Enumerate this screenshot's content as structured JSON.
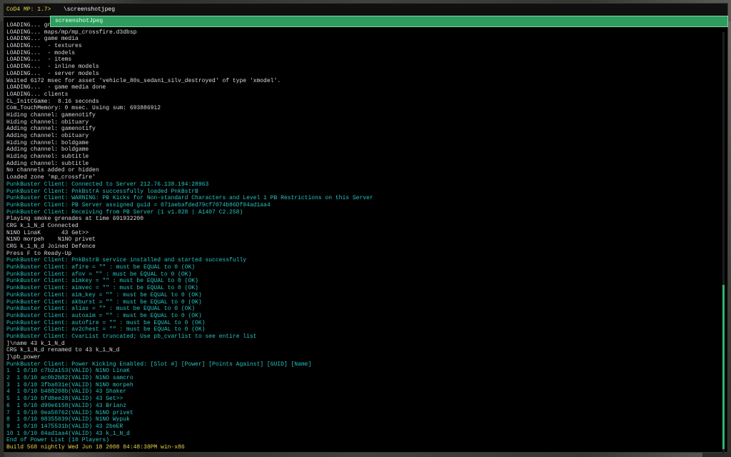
{
  "console": {
    "prompt": "CoD4 MP: 1.7> ",
    "input_value": "\\screenshotjpeg",
    "suggestion": "screenshotJpeg",
    "lines": [
      {
        "t": "LOADING... gn",
        "k": "w"
      },
      {
        "t": "LOADING... maps/mp/mp_crossfire.d3dbsp",
        "k": "w"
      },
      {
        "t": "LOADING... game media",
        "k": "w"
      },
      {
        "t": "LOADING...  - textures",
        "k": "w"
      },
      {
        "t": "LOADING...  - models",
        "k": "w"
      },
      {
        "t": "LOADING...  - items",
        "k": "w"
      },
      {
        "t": "LOADING...  - inline models",
        "k": "w"
      },
      {
        "t": "LOADING...  - server models",
        "k": "w"
      },
      {
        "t": "Waited 6172 msec for asset 'vehicle_80s_sedan1_silv_destroyed' of type 'xmodel'.",
        "k": "w"
      },
      {
        "t": "LOADING...  - game media done",
        "k": "w"
      },
      {
        "t": "LOADING... clients",
        "k": "w"
      },
      {
        "t": "CL_InitCGame:  8.16 seconds",
        "k": "w"
      },
      {
        "t": "Com_TouchMemory: 0 msec. Using sum: 693886912",
        "k": "w"
      },
      {
        "t": "Hiding channel: gamenotify",
        "k": "w"
      },
      {
        "t": "Hiding channel: obituary",
        "k": "w"
      },
      {
        "t": "Adding channel: gamenotify",
        "k": "w"
      },
      {
        "t": "Adding channel: obituary",
        "k": "w"
      },
      {
        "t": "Hiding channel: boldgame",
        "k": "w"
      },
      {
        "t": "Adding channel: boldgame",
        "k": "w"
      },
      {
        "t": "Hiding channel: subtitle",
        "k": "w"
      },
      {
        "t": "Adding channel: subtitle",
        "k": "w"
      },
      {
        "t": "No channels added or hidden",
        "k": "w"
      },
      {
        "t": "Loaded zone 'mp_crossfire'",
        "k": "w"
      },
      {
        "t": "PunkBuster Client: Connected to Server 212.76.138.194:28963",
        "k": "c"
      },
      {
        "t": "PunkBuster Client: PnkBstrA successfully loaded PnkBstrB",
        "k": "c"
      },
      {
        "t": "PunkBuster Client: WARNING: PB Kicks for Non-standard Characters and Level 1 PB Restrictions on this Server",
        "k": "c"
      },
      {
        "t": "PunkBuster Client: PB Server assigned guid = 071aebafded79cf7074b86Df04ad1aa4",
        "k": "c"
      },
      {
        "t": "PunkBuster Client: Receiving from PB Server (1 v1.828 | A1407 C2.258)",
        "k": "c"
      },
      {
        "t": "Playing smoke grenades at time 691932200",
        "k": "w"
      },
      {
        "t": "CRG k_1_N_d Connected",
        "k": "w"
      },
      {
        "t": "N1NO LinaK      43 Get>>",
        "k": "w",
        "knife": true
      },
      {
        "t": "N1NO morpeh    N1NO privet",
        "k": "w",
        "knife": true
      },
      {
        "t": "CRG k_1_N_d Joined Defence",
        "k": "w"
      },
      {
        "t": "Press F to Ready-Up",
        "k": "w"
      },
      {
        "t": "PunkBuster Client: PnkBstrB service installed and started successfully",
        "k": "c"
      },
      {
        "t": "PunkBuster Client: afire = \"\" : must be EQUAL to 0 (OK)",
        "k": "c"
      },
      {
        "t": "PunkBuster Client: afov = \"\" : must be EQUAL to 0 (OK)",
        "k": "c"
      },
      {
        "t": "PunkBuster Client: aimkey = \"\" : must be EQUAL to 0 (OK)",
        "k": "c"
      },
      {
        "t": "PunkBuster Client: aimvec = \"\" : must be EQUAL to 0 (OK)",
        "k": "c"
      },
      {
        "t": "PunkBuster Client: aim_key = \"\" : must be EQUAL to 0 (OK)",
        "k": "c"
      },
      {
        "t": "PunkBuster Client: akburst = \"\" : must be EQUAL to 0 (OK)",
        "k": "c"
      },
      {
        "t": "PunkBuster Client: alias = \"\" : must be EQUAL to 0 (OK)",
        "k": "c"
      },
      {
        "t": "PunkBuster Client: autoaim = \"\" : must be EQUAL to 0 (OK)",
        "k": "c"
      },
      {
        "t": "PunkBuster Client: autofire = \"\" : must be EQUAL to 0 (OK)",
        "k": "c"
      },
      {
        "t": "PunkBuster Client: av2chest = \"\" : must be EQUAL to 0 (OK)",
        "k": "c"
      },
      {
        "t": "PunkBuster Client: CvarList truncated; Use pb_cvarlist to see entire list",
        "k": "c"
      },
      {
        "t": "]\\name 43 k_1_N_d",
        "k": "w"
      },
      {
        "t": "CRG k_1_N_d renamed to 43 k_1_N_d",
        "k": "w"
      },
      {
        "t": "]\\pb_power",
        "k": "w"
      },
      {
        "t": "PunkBuster Client: Power Kicking Enabled: [Slot #] [Power] [Points Against] [GUID] [Name]",
        "k": "c"
      },
      {
        "t": "1  1 0/10 c7b2a153(VALID) N1NO LinaK",
        "k": "c"
      },
      {
        "t": "2  1 0/10 ac0b2b82(VALID) N1NO samcro",
        "k": "c"
      },
      {
        "t": "3  1 0/10 3fba031e(VALID) N1NO morpeh",
        "k": "c"
      },
      {
        "t": "4  1 0/10 b488208b(VALID) 43 Shaker",
        "k": "c"
      },
      {
        "t": "5  1 0/10 bfd8ee28(VALID) 43 Get>>",
        "k": "c"
      },
      {
        "t": "6  1 0/10 d99e6158(VALID) 43 Brianz",
        "k": "c"
      },
      {
        "t": "7  1 0/10 0ea50762(VALID) N1NO privet",
        "k": "c"
      },
      {
        "t": "8  1 0/10 98355039(VALID) N1NO Wypuk",
        "k": "c"
      },
      {
        "t": "9  1 0/10 1475531b(VALID) 43 2beER",
        "k": "c"
      },
      {
        "t": "10 1 0/10 04ad1aa4(VALID) 43 k_1_N_d",
        "k": "c"
      },
      {
        "t": "End of Power List (10 Players)",
        "k": "c"
      },
      {
        "t": "Build 568 nightly Wed Jun 18 2008 04:48:38PM win-x86",
        "k": "y"
      }
    ]
  },
  "colors": {
    "console_bg": "#000000",
    "default_text": "#d9d9d9",
    "punkbuster_text": "#27c3c3",
    "prompt_text": "#e8d64a",
    "suggestion_bg": "#2e9c5e",
    "scrollbar": "#2eb86a"
  },
  "scroll": {
    "thumb_position_fraction": 0.6,
    "thumb_size_fraction": 0.39
  }
}
